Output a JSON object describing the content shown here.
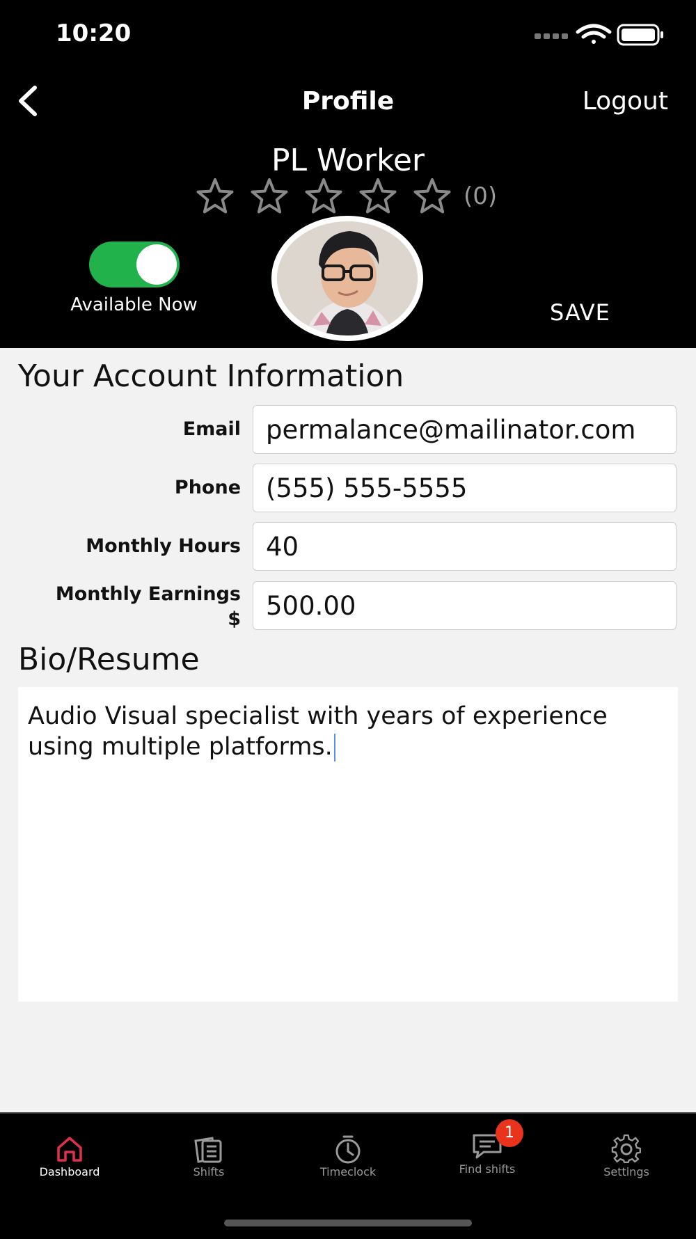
{
  "status_bar": {
    "time": "10:20"
  },
  "nav": {
    "title": "Profile",
    "logout_label": "Logout"
  },
  "profile": {
    "name": "PL Worker",
    "rating_count": "(0)",
    "rating_stars": 0,
    "rating_max": 5,
    "available_label": "Available Now",
    "available_on": true,
    "save_label": "SAVE"
  },
  "account": {
    "heading": "Your Account Information",
    "email_label": "Email",
    "email_value": "permalance@mailinator.com",
    "phone_label": "Phone",
    "phone_value": "(555) 555-5555",
    "hours_label": "Monthly Hours",
    "hours_value": "40",
    "earnings_label_1": "Monthly Earnings",
    "earnings_label_2": "$",
    "earnings_value": "500.00"
  },
  "bio": {
    "heading": "Bio/Resume",
    "text": "Audio Visual specialist with years of experience using multiple platforms."
  },
  "tabs": [
    {
      "label": "Dashboard",
      "icon": "home-icon"
    },
    {
      "label": "Shifts",
      "icon": "shifts-icon"
    },
    {
      "label": "Timeclock",
      "icon": "timer-icon"
    },
    {
      "label": "Find shifts",
      "icon": "chat-icon",
      "badge": "1"
    },
    {
      "label": "Settings",
      "icon": "gear-icon"
    }
  ],
  "colors": {
    "accent": "#e0304e",
    "toggle_on": "#22b24c",
    "badge": "#e8341c"
  }
}
